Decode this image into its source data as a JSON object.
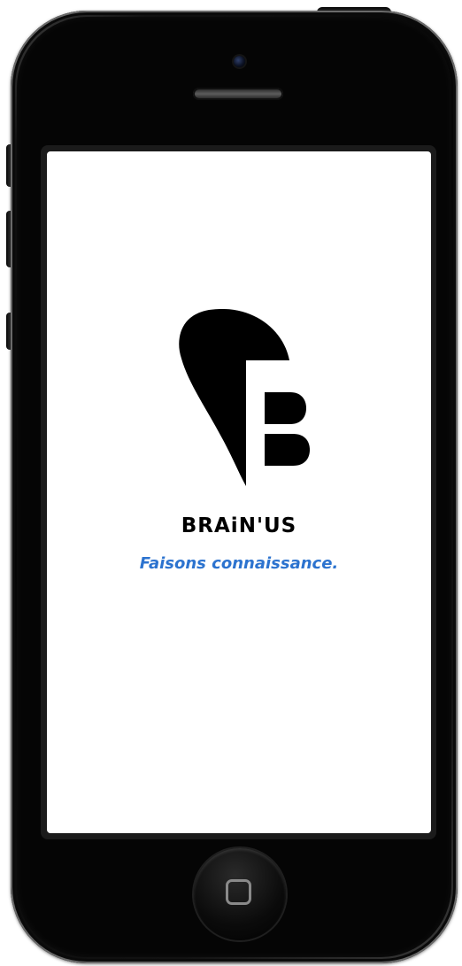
{
  "app": {
    "brand_name": "BRAiN'US",
    "tagline": "Faisons connaissance."
  },
  "colors": {
    "tagline": "#2c73cf",
    "brand": "#000000",
    "screen_background": "#ffffff",
    "device_body": "#050505"
  },
  "icons": {
    "logo": "brainus-logo-mark",
    "home": "home-button-icon",
    "camera": "front-camera",
    "speaker": "earpiece-speaker"
  }
}
